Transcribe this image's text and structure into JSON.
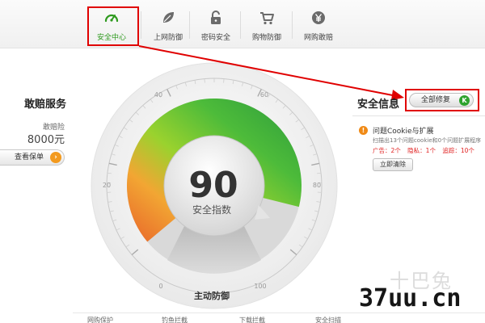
{
  "tabs": [
    {
      "label": "安全中心",
      "icon": "speedometer-icon",
      "active": true
    },
    {
      "label": "上网防御",
      "icon": "leaf-icon",
      "active": false
    },
    {
      "label": "密码安全",
      "icon": "lock-icon",
      "active": false
    },
    {
      "label": "购物防御",
      "icon": "cart-icon",
      "active": false
    },
    {
      "label": "网购敢赔",
      "icon": "yuan-icon",
      "active": false
    }
  ],
  "left_panel": {
    "title": "敢赔服务",
    "subtitle": "敢赔险",
    "amount": "8000元",
    "button_label": "查看保单",
    "button_icon": "arrow-right-icon"
  },
  "gauge": {
    "score": "90",
    "score_label": "安全指数",
    "bottom_label": "主动防御",
    "ticks": [
      "0",
      "20",
      "40",
      "60",
      "80",
      "100"
    ],
    "level_percent": 90
  },
  "right_panel": {
    "title": "安全信息",
    "fix_all_label": "全部修复",
    "fix_all_icon": "k-badge-icon",
    "issue_title": "问题Cookie与扩展",
    "issue_desc": "扫描出13个问题cookie和0个问题扩展程序",
    "issue_stats": [
      "广告：2个",
      "隐私：1个",
      "追踪：10个"
    ],
    "clean_label": "立即清除"
  },
  "bottom_nav": [
    "网购保护",
    "钓鱼拦截",
    "下载拦截",
    "安全扫描"
  ],
  "watermark": {
    "chars": "十巴兔",
    "site": "37uu.cn"
  },
  "colors": {
    "active_green": "#2e9a1e",
    "annotation_red": "#e00000",
    "warning_orange": "#f08a16"
  }
}
